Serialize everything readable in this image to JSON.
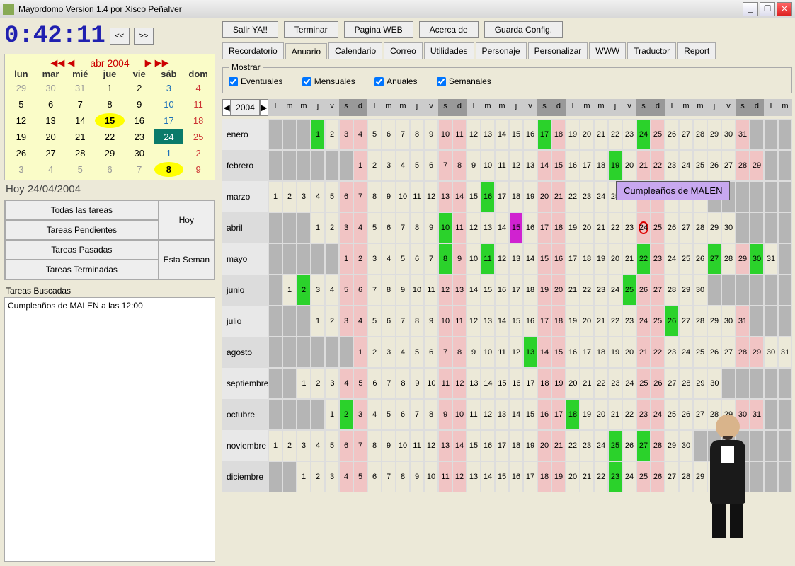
{
  "window": {
    "title": "Mayordomo Version 1.4  por Xisco Peñalver"
  },
  "clock": "0:42:11",
  "nav": {
    "prev": "<<",
    "next": ">>"
  },
  "topButtons": {
    "salir": "Salir YA!!",
    "terminar": "Terminar",
    "web": "Pagina WEB",
    "acerca": "Acerca de",
    "guarda": "Guarda Config."
  },
  "tabs": [
    "Recordatorio",
    "Anuario",
    "Calendario",
    "Correo",
    "Utilidades",
    "Personaje",
    "Personalizar",
    "WWW",
    "Traductor",
    "Report"
  ],
  "activeTab": 1,
  "mostrar": {
    "legend": "Mostrar",
    "eventuales": "Eventuales",
    "mensuales": "Mensuales",
    "anuales": "Anuales",
    "semanales": "Semanales"
  },
  "cal": {
    "title": "abr 2004",
    "dow": [
      "lun",
      "mar",
      "mié",
      "jue",
      "vie",
      "sáb",
      "dom"
    ],
    "rows": [
      [
        {
          "n": 29,
          "c": "gray"
        },
        {
          "n": 30,
          "c": "gray"
        },
        {
          "n": 31,
          "c": "gray"
        },
        {
          "n": 1,
          "c": ""
        },
        {
          "n": 2,
          "c": ""
        },
        {
          "n": 3,
          "c": "blue"
        },
        {
          "n": 4,
          "c": "red"
        }
      ],
      [
        {
          "n": 5,
          "c": ""
        },
        {
          "n": 6,
          "c": ""
        },
        {
          "n": 7,
          "c": ""
        },
        {
          "n": 8,
          "c": ""
        },
        {
          "n": 9,
          "c": ""
        },
        {
          "n": 10,
          "c": "blue"
        },
        {
          "n": 11,
          "c": "red"
        }
      ],
      [
        {
          "n": 12,
          "c": ""
        },
        {
          "n": 13,
          "c": ""
        },
        {
          "n": 14,
          "c": ""
        },
        {
          "n": 15,
          "c": "yellow"
        },
        {
          "n": 16,
          "c": ""
        },
        {
          "n": 17,
          "c": "blue"
        },
        {
          "n": 18,
          "c": "red"
        }
      ],
      [
        {
          "n": 19,
          "c": ""
        },
        {
          "n": 20,
          "c": ""
        },
        {
          "n": 21,
          "c": ""
        },
        {
          "n": 22,
          "c": ""
        },
        {
          "n": 23,
          "c": ""
        },
        {
          "n": 24,
          "c": "today"
        },
        {
          "n": 25,
          "c": "red"
        }
      ],
      [
        {
          "n": 26,
          "c": ""
        },
        {
          "n": 27,
          "c": ""
        },
        {
          "n": 28,
          "c": ""
        },
        {
          "n": 29,
          "c": ""
        },
        {
          "n": 30,
          "c": ""
        },
        {
          "n": 1,
          "c": "blue gray"
        },
        {
          "n": 2,
          "c": "gray red"
        }
      ],
      [
        {
          "n": 3,
          "c": "gray"
        },
        {
          "n": 4,
          "c": "gray"
        },
        {
          "n": 5,
          "c": "gray"
        },
        {
          "n": 6,
          "c": "gray"
        },
        {
          "n": 7,
          "c": "gray"
        },
        {
          "n": 8,
          "c": "yellow"
        },
        {
          "n": 9,
          "c": "gray red"
        }
      ]
    ],
    "today": "Hoy 24/04/2004"
  },
  "taskButtons": {
    "todas": "Todas las tareas",
    "pendientes": "Tareas Pendientes",
    "pasadas": "Tareas Pasadas",
    "terminadas": "Tareas Terminadas",
    "hoy": "Hoy",
    "semana": "Esta Seman"
  },
  "search": {
    "label": "Tareas Buscadas",
    "result": "Cumpleaños de MALEN a las 12:00"
  },
  "anuario": {
    "year": "2004",
    "dowPattern": [
      "l",
      "m",
      "m",
      "j",
      "v",
      "s",
      "d"
    ],
    "tooltip": "Cumpleaños de MALEN",
    "months": [
      {
        "name": "enero",
        "offset": 3,
        "days": 31,
        "green": [
          1,
          17,
          24
        ],
        "today": -1
      },
      {
        "name": "febrero",
        "offset": 6,
        "days": 29,
        "green": [
          19
        ],
        "today": -1
      },
      {
        "name": "marzo",
        "offset": 0,
        "days": 31,
        "green": [
          16
        ],
        "today": -1
      },
      {
        "name": "abril",
        "offset": 3,
        "days": 30,
        "green": [
          10
        ],
        "magenta": [
          15
        ],
        "today": 24
      },
      {
        "name": "mayo",
        "offset": 5,
        "days": 31,
        "green": [
          8,
          11,
          22,
          27,
          30
        ],
        "today": -1
      },
      {
        "name": "junio",
        "offset": 1,
        "days": 30,
        "green": [
          2,
          25
        ],
        "today": -1
      },
      {
        "name": "julio",
        "offset": 3,
        "days": 31,
        "green": [
          26
        ],
        "today": -1
      },
      {
        "name": "agosto",
        "offset": 6,
        "days": 31,
        "green": [
          13
        ],
        "today": -1
      },
      {
        "name": "septiembre",
        "offset": 2,
        "days": 30,
        "green": [],
        "today": -1
      },
      {
        "name": "octubre",
        "offset": 4,
        "days": 31,
        "green": [
          2,
          18
        ],
        "today": -1
      },
      {
        "name": "noviembre",
        "offset": 0,
        "days": 30,
        "green": [
          25,
          27
        ],
        "today": -1
      },
      {
        "name": "diciembre",
        "offset": 2,
        "days": 31,
        "green": [
          23
        ],
        "today": -1
      }
    ]
  }
}
